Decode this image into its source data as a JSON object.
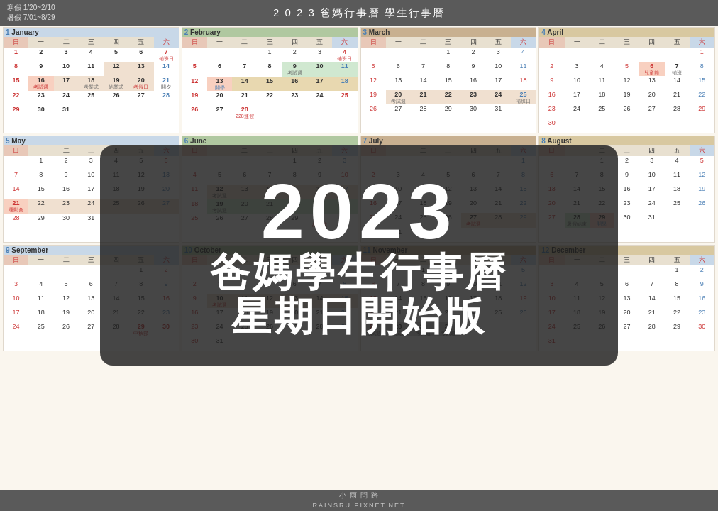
{
  "header": {
    "vacation": "寒假 1/20~2/10\n暑假 7/01~8/29",
    "title": "2 0 2 3  爸媽行事曆  學生行事曆"
  },
  "overlay": {
    "year": "2023",
    "line1": "爸媽學生行事曆",
    "line2": "星期日開始版"
  },
  "footer": {
    "text": "小 雨 問 路\nRAINSRU.PIXNET.NET"
  },
  "months": [
    {
      "num": "1",
      "name": "January"
    },
    {
      "num": "2",
      "name": "February"
    },
    {
      "num": "3",
      "name": "March"
    },
    {
      "num": "4",
      "name": "April"
    },
    {
      "num": "5",
      "name": "May"
    },
    {
      "num": "6",
      "name": "June"
    },
    {
      "num": "7",
      "name": "July"
    },
    {
      "num": "8",
      "name": "August"
    },
    {
      "num": "9",
      "name": "September"
    },
    {
      "num": "10",
      "name": "October"
    },
    {
      "num": "11",
      "name": "November"
    },
    {
      "num": "12",
      "name": "December"
    }
  ]
}
